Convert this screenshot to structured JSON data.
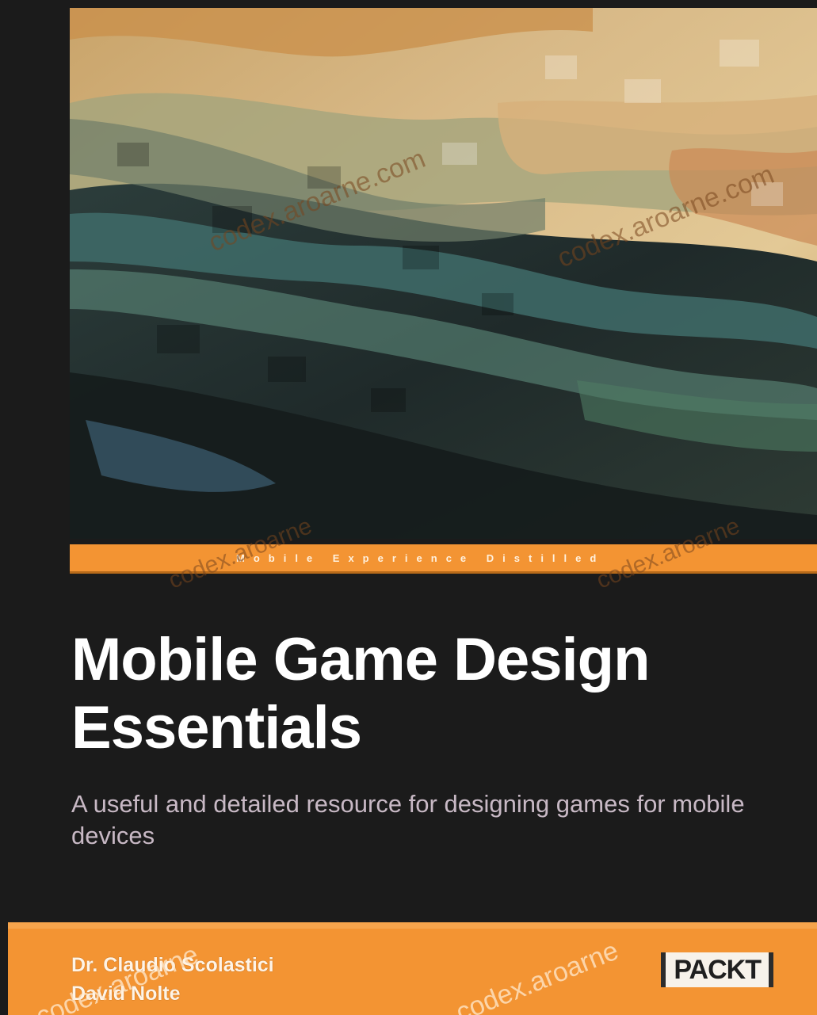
{
  "cover": {
    "series_band": "Mobile Experience Distilled",
    "title_line_1": "Mobile Game Design",
    "title_line_2": "Essentials",
    "subtitle": "A useful and detailed resource for designing games for mobile devices",
    "authors": [
      "Dr. Claudio Scolastici",
      "David Nolte"
    ],
    "publisher": "PACKT"
  },
  "watermark": {
    "text_art": "codex.aroarne.com",
    "text_band": "codex.aroarne",
    "text_footer_left": "codex.aroarne",
    "text_footer_right": "codex.aroarne"
  },
  "colors": {
    "background": "#1b1b1b",
    "accent_orange": "#f39433",
    "title": "#ffffff",
    "subtitle": "#c8b9c5"
  }
}
